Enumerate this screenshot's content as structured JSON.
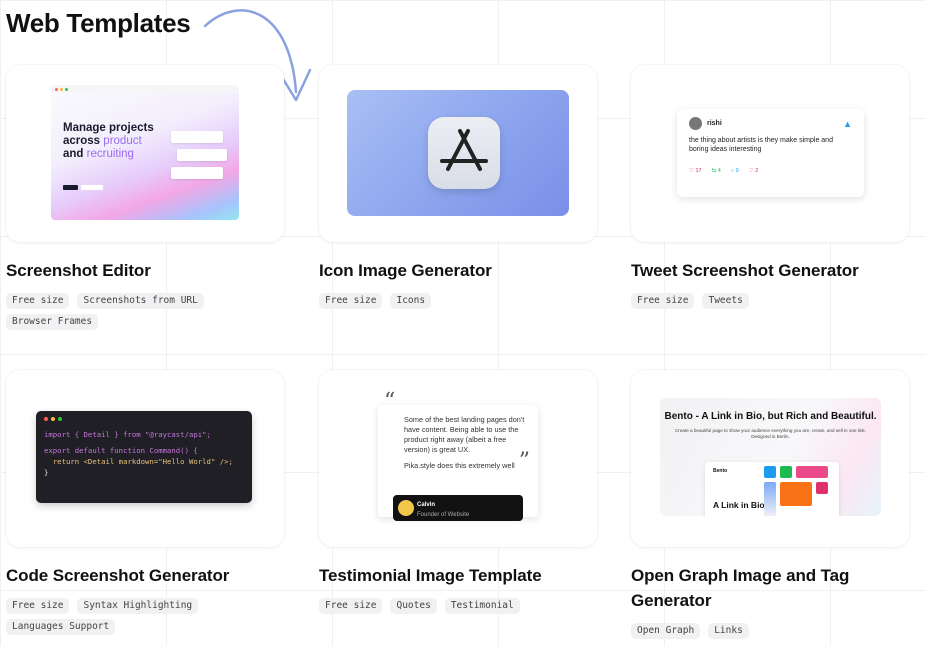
{
  "header": {
    "title": "Web Templates"
  },
  "templates": [
    {
      "title": "Screenshot Editor",
      "tags": [
        "Free size",
        "Screenshots from URL",
        "Browser Frames"
      ]
    },
    {
      "title": "Icon Image Generator",
      "tags": [
        "Free size",
        "Icons"
      ]
    },
    {
      "title": "Tweet Screenshot Generator",
      "tags": [
        "Free size",
        "Tweets"
      ]
    },
    {
      "title": "Code Screenshot Generator",
      "tags": [
        "Free size",
        "Syntax Highlighting",
        "Languages Support"
      ]
    },
    {
      "title": "Testimonial Image Template",
      "tags": [
        "Free size",
        "Quotes",
        "Testimonial"
      ]
    },
    {
      "title": "Open Graph Image and Tag Generator",
      "tags": [
        "Open Graph",
        "Links"
      ]
    }
  ],
  "previews": {
    "screenshot_editor": {
      "heading_line1": "Manage projects",
      "heading_line2a": "across",
      "heading_line2b": "product",
      "heading_line3a": "and",
      "heading_line3b": "recruiting"
    },
    "tweet": {
      "name": "rishi",
      "text": "the thing about artists is they make simple and boring ideas interesting",
      "replies": "17",
      "retweets": "4",
      "comments": "9",
      "likes": "2"
    },
    "code": {
      "line1": "import { Detail } from \"@raycast/api\";",
      "line2": "export default function Command() {",
      "line3": "  return <Detail markdown=\"Hello World\" />;",
      "line4": "}"
    },
    "testimonial": {
      "quote": "Some of the best landing pages don't have content. Being able to use the product right away (albeit a free version) is great UX.",
      "quote2": "Pika.style does this extremely well",
      "author": "Calvin",
      "role": "Founder of Website"
    },
    "og": {
      "title": "Bento - A Link in Bio, but Rich and Beautiful.",
      "subtitle": "Create a beautiful page to show your audience everything you are, create, and sell in one link. Designed in Berlin.",
      "brand": "Bento",
      "window_heading": "A Link in Bio."
    }
  },
  "colors": {
    "accent": "#7b93dc",
    "tag_bg": "#f1f1f3"
  }
}
